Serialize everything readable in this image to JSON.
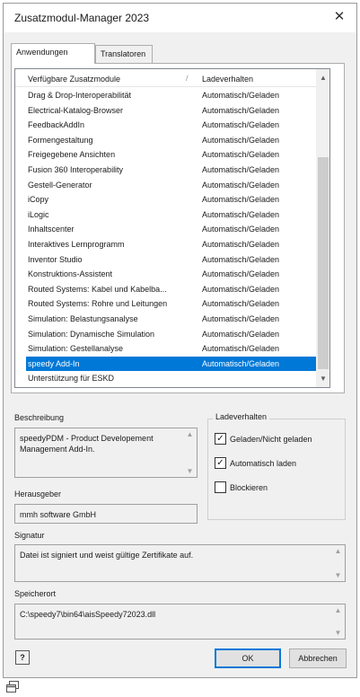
{
  "window": {
    "title": "Zusatzmodul-Manager 2023",
    "close_symbol": "✕"
  },
  "tabs": [
    {
      "label": "Anwendungen",
      "active": true
    },
    {
      "label": "Translatoren",
      "active": false
    }
  ],
  "list": {
    "header": {
      "name": "Verfügbare Zusatzmodule",
      "separator": "/",
      "load": "Ladeverhalten"
    },
    "rows": [
      {
        "name": "Drag & Drop-Interoperabilität",
        "load": "Automatisch/Geladen",
        "selected": false
      },
      {
        "name": "Electrical-Katalog-Browser",
        "load": "Automatisch/Geladen",
        "selected": false
      },
      {
        "name": "FeedbackAddIn",
        "load": "Automatisch/Geladen",
        "selected": false
      },
      {
        "name": "Formengestaltung",
        "load": "Automatisch/Geladen",
        "selected": false
      },
      {
        "name": "Freigegebene Ansichten",
        "load": "Automatisch/Geladen",
        "selected": false
      },
      {
        "name": "Fusion 360 Interoperability",
        "load": "Automatisch/Geladen",
        "selected": false
      },
      {
        "name": "Gestell-Generator",
        "load": "Automatisch/Geladen",
        "selected": false
      },
      {
        "name": "iCopy",
        "load": "Automatisch/Geladen",
        "selected": false
      },
      {
        "name": "iLogic",
        "load": "Automatisch/Geladen",
        "selected": false
      },
      {
        "name": "Inhaltscenter",
        "load": "Automatisch/Geladen",
        "selected": false
      },
      {
        "name": "Interaktives Lernprogramm",
        "load": "Automatisch/Geladen",
        "selected": false
      },
      {
        "name": "Inventor Studio",
        "load": "Automatisch/Geladen",
        "selected": false
      },
      {
        "name": "Konstruktions-Assistent",
        "load": "Automatisch/Geladen",
        "selected": false
      },
      {
        "name": "Routed Systems: Kabel und Kabelba...",
        "load": "Automatisch/Geladen",
        "selected": false
      },
      {
        "name": "Routed Systems: Rohre und Leitungen",
        "load": "Automatisch/Geladen",
        "selected": false
      },
      {
        "name": "Simulation: Belastungsanalyse",
        "load": "Automatisch/Geladen",
        "selected": false
      },
      {
        "name": "Simulation: Dynamische Simulation",
        "load": "Automatisch/Geladen",
        "selected": false
      },
      {
        "name": "Simulation: Gestellanalyse",
        "load": "Automatisch/Geladen",
        "selected": false
      },
      {
        "name": "speedy Add-In",
        "load": "Automatisch/Geladen",
        "selected": true
      },
      {
        "name": "Unterstützung für ESKD",
        "load": "",
        "selected": false
      }
    ],
    "scroll_up": "▲",
    "scroll_down": "▼"
  },
  "details": {
    "description_label": "Beschreibung",
    "description_text": "speedyPDM - Product Developement Management Add-In.",
    "publisher_label": "Herausgeber",
    "publisher_text": "mmh software GmbH",
    "signature_label": "Signatur",
    "signature_text": "Datei ist signiert und weist gültige Zertifikate auf.",
    "location_label": "Speicherort",
    "location_text": "C:\\speedy7\\bin64\\aisSpeedy72023.dll"
  },
  "load_behavior": {
    "title": "Ladeverhalten",
    "options": [
      {
        "label": "Geladen/Nicht geladen",
        "checked": true
      },
      {
        "label": "Automatisch laden",
        "checked": true
      },
      {
        "label": "Blockieren",
        "checked": false
      }
    ]
  },
  "buttons": {
    "help": "?",
    "ok": "OK",
    "cancel": "Abbrechen"
  },
  "colors": {
    "selection": "#0078d7",
    "dialog_bg": "#f0f0f0"
  }
}
